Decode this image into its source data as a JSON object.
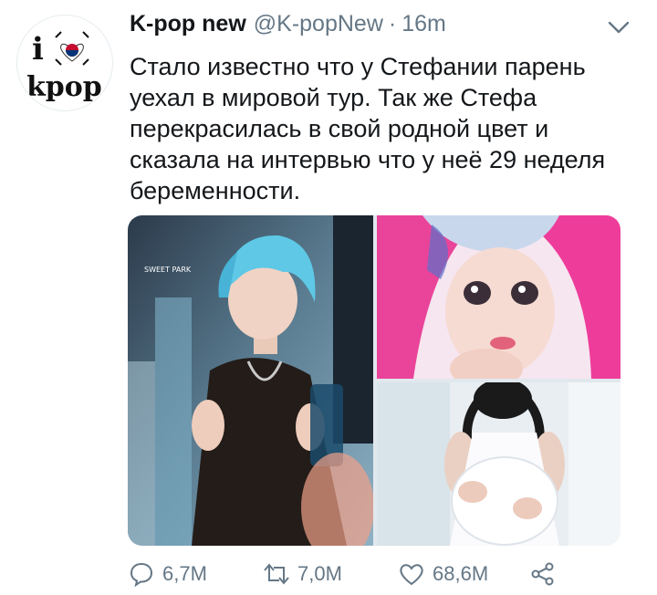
{
  "tweet": {
    "author_name": "K-pop new",
    "author_handle": "@K-popNew",
    "separator": "·",
    "time": "16m",
    "text": "Стало известно что у Стефании парень уехал в мировой тур. Так же Стефа перекрасилась в свой родной цвет и сказала на интервью что у неё 29 неделя беременности.",
    "avatar": {
      "text_top": "i",
      "text_bottom": "kpop",
      "icon": "korean-flag-heart"
    },
    "media": [
      {
        "description_icon": "photo-blue-hair-boy",
        "watermark": "SWEET PARK"
      },
      {
        "description_icon": "photo-pink-hair-girl"
      },
      {
        "description_icon": "photo-pregnant-woman"
      }
    ]
  },
  "actions": {
    "reply_count": "6,7M",
    "retweet_count": "7,0M",
    "like_count": "68,6M"
  },
  "colors": {
    "text": "#14171a",
    "secondary": "#657786",
    "icon": "#657786"
  }
}
